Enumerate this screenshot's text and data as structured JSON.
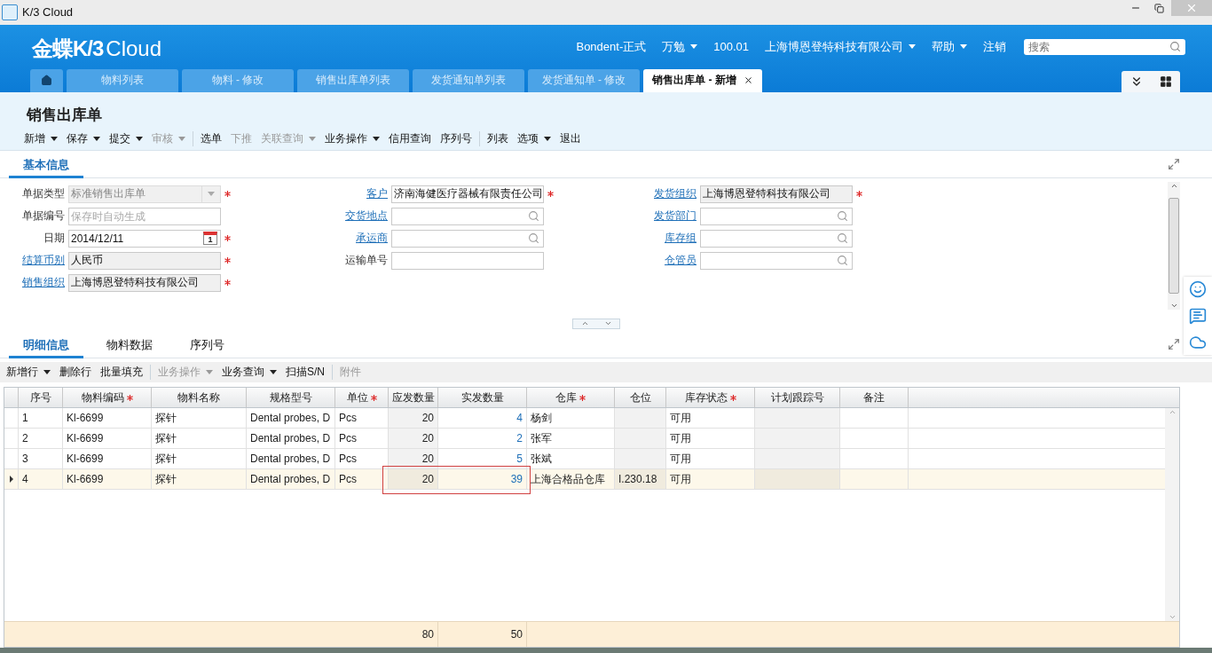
{
  "window": {
    "title": "K/3 Cloud"
  },
  "header": {
    "logo_main": "金蝶K/3",
    "logo_sub": "Cloud",
    "menus": [
      {
        "label": "Bondent-正式",
        "caret": false
      },
      {
        "label": "万勉",
        "caret": true
      },
      {
        "label": "100.01",
        "caret": false
      },
      {
        "label": "上海博恩登特科技有限公司",
        "caret": true
      },
      {
        "label": "帮助",
        "caret": true
      },
      {
        "label": "注销",
        "caret": false
      }
    ],
    "search": {
      "placeholder": "搜索"
    }
  },
  "tabs": [
    {
      "label": "物料列表",
      "selected": false,
      "closable": false
    },
    {
      "label": "物料 - 修改",
      "selected": false,
      "closable": false
    },
    {
      "label": "销售出库单列表",
      "selected": false,
      "closable": false
    },
    {
      "label": "发货通知单列表",
      "selected": false,
      "closable": false
    },
    {
      "label": "发货通知单 - 修改",
      "selected": false,
      "closable": false
    },
    {
      "label": "销售出库单 - 新增",
      "selected": true,
      "closable": true
    }
  ],
  "page_title": "销售出库单",
  "toolbar": [
    [
      {
        "label": "新增",
        "caret": true,
        "disabled": false
      },
      {
        "label": "保存",
        "caret": true,
        "disabled": false
      },
      {
        "label": "提交",
        "caret": true,
        "disabled": false
      },
      {
        "label": "审核",
        "caret": true,
        "disabled": true
      }
    ],
    [
      {
        "label": "选单",
        "caret": false,
        "disabled": false
      },
      {
        "label": "下推",
        "caret": false,
        "disabled": true
      },
      {
        "label": "关联查询",
        "caret": true,
        "disabled": true
      },
      {
        "label": "业务操作",
        "caret": true,
        "disabled": false
      },
      {
        "label": "信用查询",
        "caret": false,
        "disabled": false
      },
      {
        "label": "序列号",
        "caret": false,
        "disabled": false
      }
    ],
    [
      {
        "label": "列表",
        "caret": false,
        "disabled": false
      },
      {
        "label": "选项",
        "caret": true,
        "disabled": false
      },
      {
        "label": "退出",
        "caret": false,
        "disabled": false
      }
    ]
  ],
  "basic_section": {
    "title": "基本信息",
    "columns": [
      [
        {
          "label": "单据类型",
          "link": false,
          "kind": "select",
          "value": "标准销售出库单",
          "required": true,
          "readonly": true,
          "disabled": true
        },
        {
          "label": "单据编号",
          "link": false,
          "kind": "text",
          "placeholder": "保存时自动生成",
          "required": false,
          "readonly": false,
          "disabled": false
        },
        {
          "label": "日期",
          "link": false,
          "kind": "date",
          "value": "2014/12/11",
          "calendar_day": "1",
          "required": true,
          "readonly": false,
          "disabled": false
        },
        {
          "label": "结算币别",
          "link": true,
          "kind": "text",
          "value": "人民币",
          "required": true,
          "readonly": true,
          "disabled": false
        },
        {
          "label": "销售组织",
          "link": true,
          "kind": "text",
          "value": "上海博恩登特科技有限公司",
          "required": true,
          "readonly": true,
          "disabled": false
        }
      ],
      [
        {
          "label": "客户",
          "link": true,
          "kind": "text",
          "value": "济南海健医疗器械有限责任公司",
          "required": true,
          "readonly": false,
          "disabled": false
        },
        {
          "label": "交货地点",
          "link": true,
          "kind": "lookup",
          "required": false,
          "readonly": false,
          "disabled": false
        },
        {
          "label": "承运商",
          "link": true,
          "kind": "lookup",
          "required": false,
          "readonly": false,
          "disabled": false
        },
        {
          "label": "运输单号",
          "link": false,
          "kind": "text",
          "required": false,
          "readonly": false,
          "disabled": false
        }
      ],
      [
        {
          "label": "发货组织",
          "link": true,
          "kind": "text",
          "value": "上海博恩登特科技有限公司",
          "required": true,
          "readonly": true,
          "disabled": false
        },
        {
          "label": "发货部门",
          "link": true,
          "kind": "lookup",
          "required": false,
          "readonly": false,
          "disabled": false
        },
        {
          "label": "库存组",
          "link": true,
          "kind": "lookup",
          "required": false,
          "readonly": false,
          "disabled": false
        },
        {
          "label": "仓管员",
          "link": true,
          "kind": "lookup",
          "required": false,
          "readonly": false,
          "disabled": false
        }
      ]
    ]
  },
  "detail_tabs": [
    {
      "label": "明细信息",
      "selected": true
    },
    {
      "label": "物料数据",
      "selected": false
    },
    {
      "label": "序列号",
      "selected": false
    }
  ],
  "detail_toolbar": [
    [
      {
        "label": "新增行",
        "caret": true,
        "disabled": false
      },
      {
        "label": "删除行",
        "caret": false,
        "disabled": false
      },
      {
        "label": "批量填充",
        "caret": false,
        "disabled": false
      }
    ],
    [
      {
        "label": "业务操作",
        "caret": true,
        "disabled": true
      },
      {
        "label": "业务查询",
        "caret": true,
        "disabled": false
      },
      {
        "label": "扫描S/N",
        "caret": false,
        "disabled": false
      }
    ],
    [
      {
        "label": "附件",
        "caret": false,
        "disabled": true
      }
    ]
  ],
  "table": {
    "columns": [
      {
        "label": "序号",
        "required": false,
        "kind": "text",
        "locked": false
      },
      {
        "label": "物料编码",
        "required": true,
        "kind": "text",
        "locked": false
      },
      {
        "label": "物料名称",
        "required": false,
        "kind": "text",
        "locked": false
      },
      {
        "label": "规格型号",
        "required": false,
        "kind": "text",
        "locked": false
      },
      {
        "label": "单位",
        "required": true,
        "kind": "text",
        "locked": false
      },
      {
        "label": "应发数量",
        "required": false,
        "kind": "number",
        "locked": true,
        "total": "80"
      },
      {
        "label": "实发数量",
        "required": false,
        "kind": "input-number",
        "locked": false,
        "total": "50"
      },
      {
        "label": "仓库",
        "required": true,
        "kind": "text",
        "locked": false
      },
      {
        "label": "仓位",
        "required": false,
        "kind": "text",
        "locked": true
      },
      {
        "label": "库存状态",
        "required": true,
        "kind": "text",
        "locked": false
      },
      {
        "label": "计划跟踪号",
        "required": false,
        "kind": "text",
        "locked": true
      },
      {
        "label": "备注",
        "required": false,
        "kind": "text",
        "locked": false
      }
    ],
    "rows": [
      {
        "no": "1",
        "code": "Kl-6699",
        "name": "探针",
        "spec": "Dental probes, D",
        "unit": "Pcs",
        "qty_due": "20",
        "qty_actual": "4",
        "warehouse": "杨剑",
        "stock_status": "可用",
        "selected": false,
        "flagged": false
      },
      {
        "no": "2",
        "code": "Kl-6699",
        "name": "探针",
        "spec": "Dental probes, D",
        "unit": "Pcs",
        "qty_due": "20",
        "qty_actual": "2",
        "warehouse": "张军",
        "stock_status": "可用",
        "selected": false,
        "flagged": false
      },
      {
        "no": "3",
        "code": "Kl-6699",
        "name": "探针",
        "spec": "Dental probes, D",
        "unit": "Pcs",
        "qty_due": "20",
        "qty_actual": "5",
        "warehouse": "张斌",
        "stock_status": "可用",
        "selected": false,
        "flagged": false
      },
      {
        "no": "4",
        "code": "Kl-6699",
        "name": "探针",
        "spec": "Dental probes, D",
        "unit": "Pcs",
        "qty_due": "20",
        "qty_actual": "39",
        "warehouse": "上海合格品仓库",
        "location": "I.230.18",
        "stock_status": "可用",
        "selected": true,
        "flagged": true
      }
    ]
  }
}
